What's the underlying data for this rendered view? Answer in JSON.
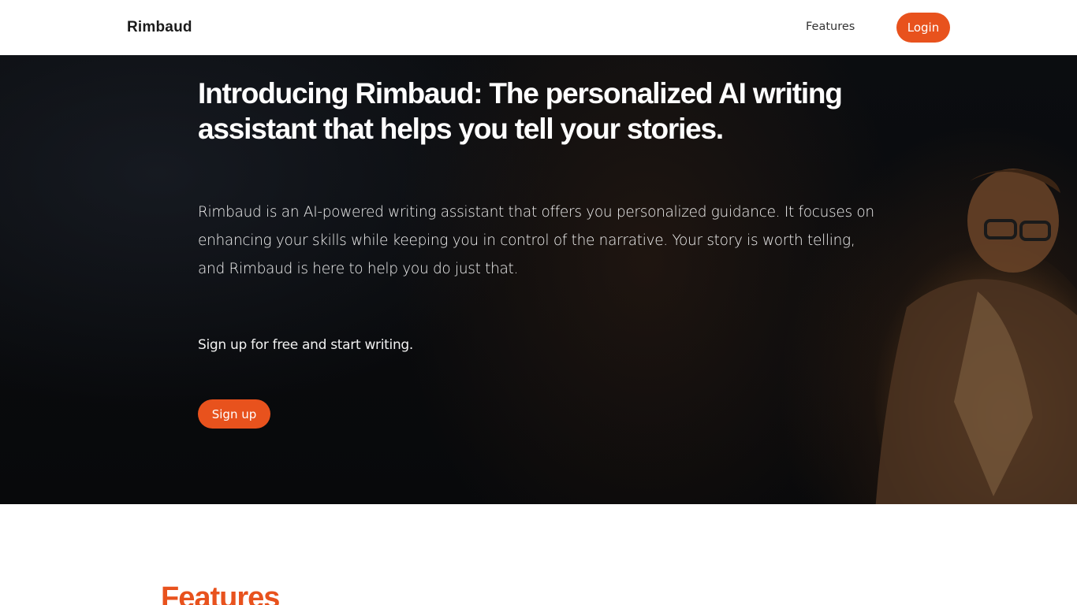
{
  "nav": {
    "brand": "Rimbaud",
    "features_link": "Features",
    "login_label": "Login"
  },
  "hero": {
    "title": "Introducing Rimbaud: The personalized AI writing assistant that helps you tell your stories.",
    "description": "Rimbaud is an AI-powered writing assistant that offers you personalized guidance. It focuses on enhancing your skills while keeping you in control of the narrative. Your story is worth telling, and Rimbaud is here to help you do just that.",
    "cta_text": "Sign up for free and start writing.",
    "signup_label": "Sign up"
  },
  "features": {
    "heading": "Features"
  },
  "colors": {
    "accent": "#e8521d",
    "hero_bg": "#0b0d10"
  }
}
